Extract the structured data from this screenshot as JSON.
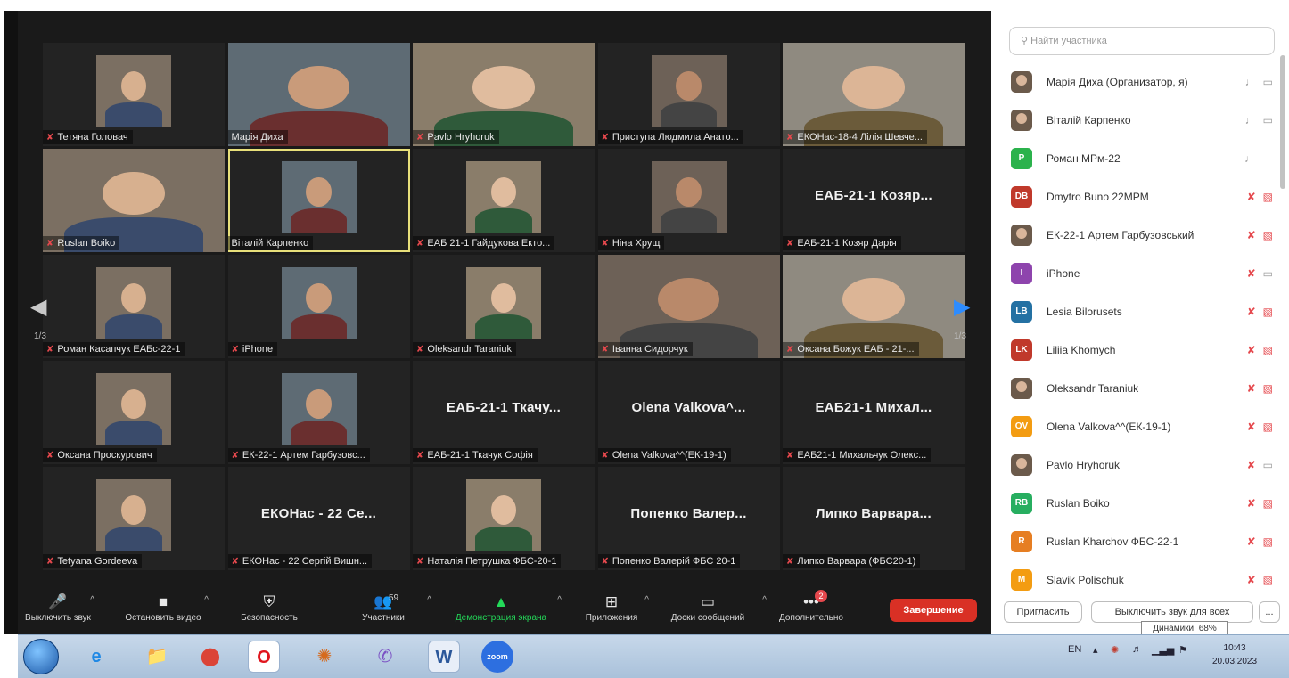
{
  "participants_grid": [
    {
      "label": "Тетяна Головач",
      "big": "",
      "photo": true,
      "muted": true
    },
    {
      "label": "Марія Диха",
      "big": "",
      "photo": "wide",
      "muted": false
    },
    {
      "label": "Pavlo Hryhoruk",
      "big": "",
      "photo": "wide",
      "muted": true
    },
    {
      "label": "Приступа Людмила Анато...",
      "big": "",
      "photo": true,
      "muted": true
    },
    {
      "label": "ЕКОНас-18-4 Лілія Шевче...",
      "big": "",
      "photo": "wide",
      "muted": true
    },
    {
      "label": "Ruslan Boiko",
      "big": "",
      "photo": "wide",
      "muted": true
    },
    {
      "label": "Віталій Карпенко",
      "big": "",
      "photo": true,
      "muted": false,
      "active": true
    },
    {
      "label": "ЕАБ 21-1 Гайдукова Екто...",
      "big": "",
      "photo": true,
      "muted": true
    },
    {
      "label": "Ніна Хрущ",
      "big": "",
      "photo": true,
      "muted": true
    },
    {
      "label": "ЕАБ-21-1 Козяр Дарія",
      "big": "ЕАБ-21-1 Козяр...",
      "photo": false,
      "muted": true
    },
    {
      "label": "Роман Касапчук ЕАБс-22-1",
      "big": "",
      "photo": true,
      "muted": true
    },
    {
      "label": "iPhone",
      "big": "",
      "photo": true,
      "muted": true
    },
    {
      "label": "Oleksandr Taraniuk",
      "big": "",
      "photo": true,
      "muted": true
    },
    {
      "label": "Іванна Сидорчук",
      "big": "",
      "photo": "wide",
      "muted": true
    },
    {
      "label": "Оксана Божук ЕАБ - 21-...",
      "big": "",
      "photo": "wide",
      "muted": true
    },
    {
      "label": "Оксана Проскурович",
      "big": "",
      "photo": true,
      "muted": true
    },
    {
      "label": "ЕК-22-1 Артем Гарбузовс...",
      "big": "",
      "photo": true,
      "muted": true
    },
    {
      "label": "ЕАБ-21-1 Ткачук Софія",
      "big": "ЕАБ-21-1 Ткачу...",
      "photo": false,
      "muted": true
    },
    {
      "label": "Olena Valkova^^(ЕК-19-1)",
      "big": "Olena Valkova^...",
      "photo": false,
      "muted": true
    },
    {
      "label": "ЕАБ21-1 Михальчук Олекс...",
      "big": "ЕАБ21-1 Михал...",
      "photo": false,
      "muted": true
    },
    {
      "label": "Tetyana Gordeeva",
      "big": "",
      "photo": true,
      "muted": true
    },
    {
      "label": "ЕКОНас - 22 Сергій Вишн...",
      "big": "ЕКОНас - 22 Се...",
      "photo": false,
      "muted": true
    },
    {
      "label": "Наталія Петрушка ФБС-20-1",
      "big": "",
      "photo": true,
      "muted": true
    },
    {
      "label": "Попенко Валерій ФБС 20-1",
      "big": "Попенко Валер...",
      "photo": false,
      "muted": true
    },
    {
      "label": "Липко Варвара (ФБС20-1)",
      "big": "Липко Варвара...",
      "photo": false,
      "muted": true
    }
  ],
  "page_indicator_left": "1/3",
  "page_indicator_right": "1/3",
  "toolbar": {
    "mute": "Выключить звук",
    "stop_video": "Остановить видео",
    "security": "Безопасность",
    "participants": "Участники",
    "participants_count": "59",
    "share": "Демонстрация экрана",
    "apps": "Приложения",
    "boards": "Доски сообщений",
    "more": "Дополнительно",
    "more_badge": "2",
    "end": "Завершение"
  },
  "panel": {
    "search_placeholder": "Найти участника",
    "invite": "Пригласить",
    "mute_all": "Выключить звук для всех",
    "more": "...",
    "tooltip": "Динамики: 68%"
  },
  "panel_list": [
    {
      "name": "Марія Диха (Организатор, я)",
      "avatar": "",
      "color": "",
      "mic": "ok",
      "cam": "ok"
    },
    {
      "name": "Віталій Карпенко",
      "avatar": "",
      "color": "",
      "mic": "on",
      "cam": "ok"
    },
    {
      "name": "Роман МРм-22",
      "avatar": "P",
      "color": "#2bb24c",
      "mic": "ok",
      "cam": ""
    },
    {
      "name": "Dmytro Buno 22MPM",
      "avatar": "DB",
      "color": "#c0392b",
      "mic": "off",
      "cam": "off"
    },
    {
      "name": "ЕК-22-1 Артем Гарбузовський",
      "avatar": "",
      "color": "",
      "mic": "off",
      "cam": "off"
    },
    {
      "name": "iPhone",
      "avatar": "I",
      "color": "#8e44ad",
      "mic": "off",
      "cam": "ok"
    },
    {
      "name": "Lesia Bilorusets",
      "avatar": "LB",
      "color": "#2471a3",
      "mic": "off",
      "cam": "off"
    },
    {
      "name": "Liliia Khomych",
      "avatar": "LK",
      "color": "#c0392b",
      "mic": "off",
      "cam": "off"
    },
    {
      "name": "Oleksandr Taraniuk",
      "avatar": "",
      "color": "",
      "mic": "off",
      "cam": "off"
    },
    {
      "name": "Olena Valkova^^(ЕК-19-1)",
      "avatar": "OV",
      "color": "#f39c12",
      "mic": "off",
      "cam": "off"
    },
    {
      "name": "Pavlo Hryhoruk",
      "avatar": "",
      "color": "",
      "mic": "off",
      "cam": "ok"
    },
    {
      "name": "Ruslan Boiko",
      "avatar": "RB",
      "color": "#27ae60",
      "mic": "off",
      "cam": "off"
    },
    {
      "name": "Ruslan Kharchov ФБС-22-1",
      "avatar": "R",
      "color": "#e67e22",
      "mic": "off",
      "cam": "off"
    },
    {
      "name": "Slavik Polischuk",
      "avatar": "M",
      "color": "#f39c12",
      "mic": "off",
      "cam": "off"
    }
  ],
  "taskbar": {
    "lang": "EN",
    "time": "10:43",
    "date": "20.03.2023",
    "word_label": "W",
    "zoom_label": "zoom"
  }
}
